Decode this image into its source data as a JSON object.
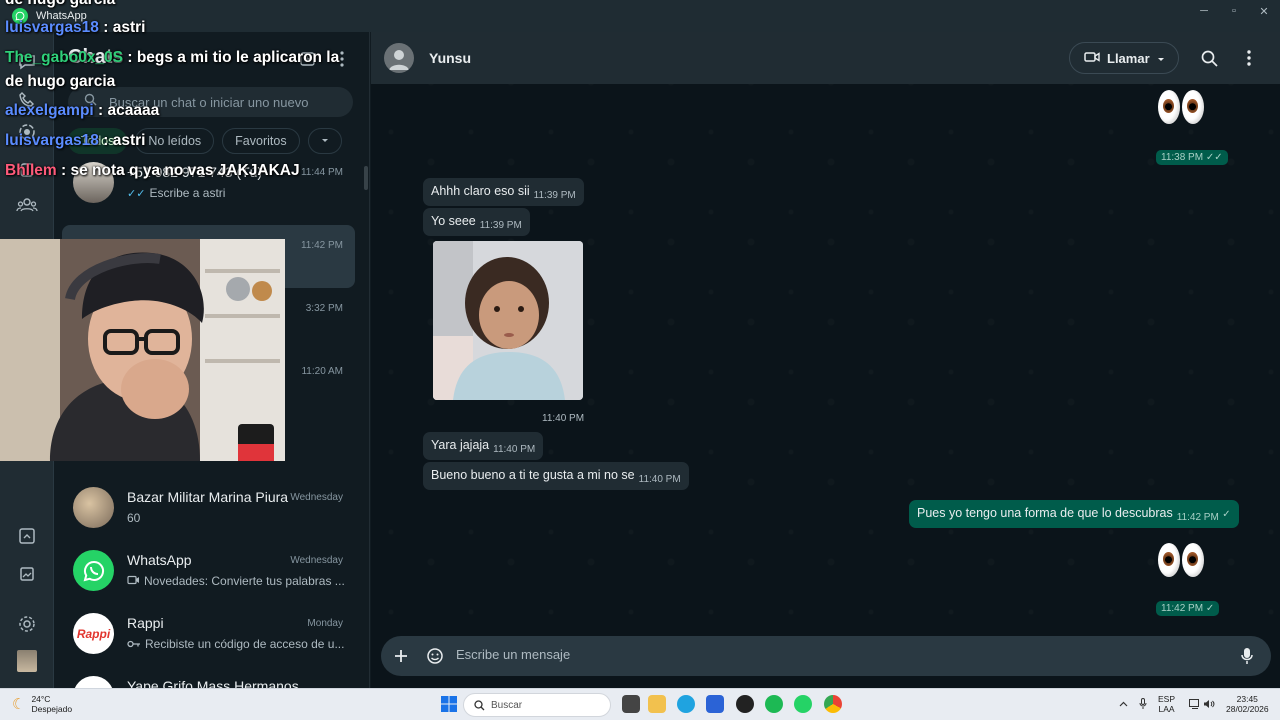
{
  "window": {
    "title": "WhatsApp",
    "controls": {
      "minimize": "─",
      "maximize": "▫",
      "close": "✕"
    }
  },
  "chat_list": {
    "header_title": "Chats",
    "search_placeholder": "Buscar un chat o iniciar uno nuevo",
    "filters": [
      "Todos",
      "No leídos",
      "Favoritos"
    ],
    "items": [
      {
        "name": "+51 982 971 743 (Tú)",
        "time": "11:44 PM",
        "preview": "Escribe a astri",
        "preview_icon": "double-check"
      },
      {
        "name": "",
        "time": "11:42 PM",
        "preview": ""
      },
      {
        "name": "",
        "time": "3:32 PM",
        "preview": ""
      },
      {
        "name": "",
        "time": "11:20 AM",
        "preview": ""
      },
      {
        "name": "Bazar Militar Marina Piura",
        "time": "Wednesday",
        "preview": "60"
      },
      {
        "name": "WhatsApp",
        "time": "Wednesday",
        "preview": "Novedades: Convierte tus palabras ...",
        "preview_icon": "video"
      },
      {
        "name": "Rappi",
        "time": "Monday",
        "preview": "Recibiste un código de acceso de u...",
        "preview_icon": "key"
      },
      {
        "name": "Yape Grifo Mass Hermanos",
        "time": "",
        "preview": ""
      }
    ]
  },
  "conversation": {
    "contact_name": "Yunsu",
    "call_label": "Llamar",
    "composer_placeholder": "Escribe un mensaje",
    "messages": [
      {
        "dir": "out",
        "text": "",
        "time": "11:38 PM",
        "kind": "emoji-eyes"
      },
      {
        "dir": "in",
        "text": "Ahhh claro eso sii",
        "time": "11:39 PM"
      },
      {
        "dir": "in",
        "text": "Yo seee",
        "time": "11:39 PM"
      },
      {
        "dir": "in",
        "text": "",
        "time": "11:40 PM",
        "kind": "photo"
      },
      {
        "dir": "in",
        "text": "Yara jajaja",
        "time": "11:40 PM"
      },
      {
        "dir": "in",
        "text": "Bueno bueno a ti te gusta a mi no se",
        "time": "11:40 PM"
      },
      {
        "dir": "out",
        "text": "Pues yo tengo una forma de que lo descubras",
        "time": "11:42 PM"
      },
      {
        "dir": "out",
        "text": "",
        "time": "11:42 PM",
        "kind": "emoji-eyes"
      }
    ]
  },
  "stream_overlay": {
    "lines": [
      {
        "user": "",
        "text": "de hugo garcia"
      },
      {
        "user": "luisvargas18",
        "text": "astri",
        "color": "#5b8cff"
      },
      {
        "user": "The_gabo0x_0S",
        "text": "begs a mi tio le aplicaron la",
        "color": "#2fd07a"
      },
      {
        "user": "",
        "text": "de hugo garcia"
      },
      {
        "user": "alexelgampi",
        "text": "acaaaa",
        "color": "#5b8cff"
      },
      {
        "user": "luisvargas18",
        "text": "astri",
        "color": "#5b8cff"
      },
      {
        "user": "Bhllem",
        "text": "se nota q ya no vas JAKJAKAJ",
        "color": "#ff5a7a"
      }
    ]
  },
  "taskbar": {
    "weather_temp": "24°C",
    "weather_desc": "Despejado",
    "search_label": "Buscar",
    "lang_top": "ESP",
    "lang_bottom": "LAA",
    "clock_time": "23:45",
    "clock_date": "28/02/2026"
  },
  "colors": {
    "accent": "#00a884",
    "bubble_out": "#005c4b",
    "bubble_in": "#202c33",
    "background": "#0b141a"
  }
}
